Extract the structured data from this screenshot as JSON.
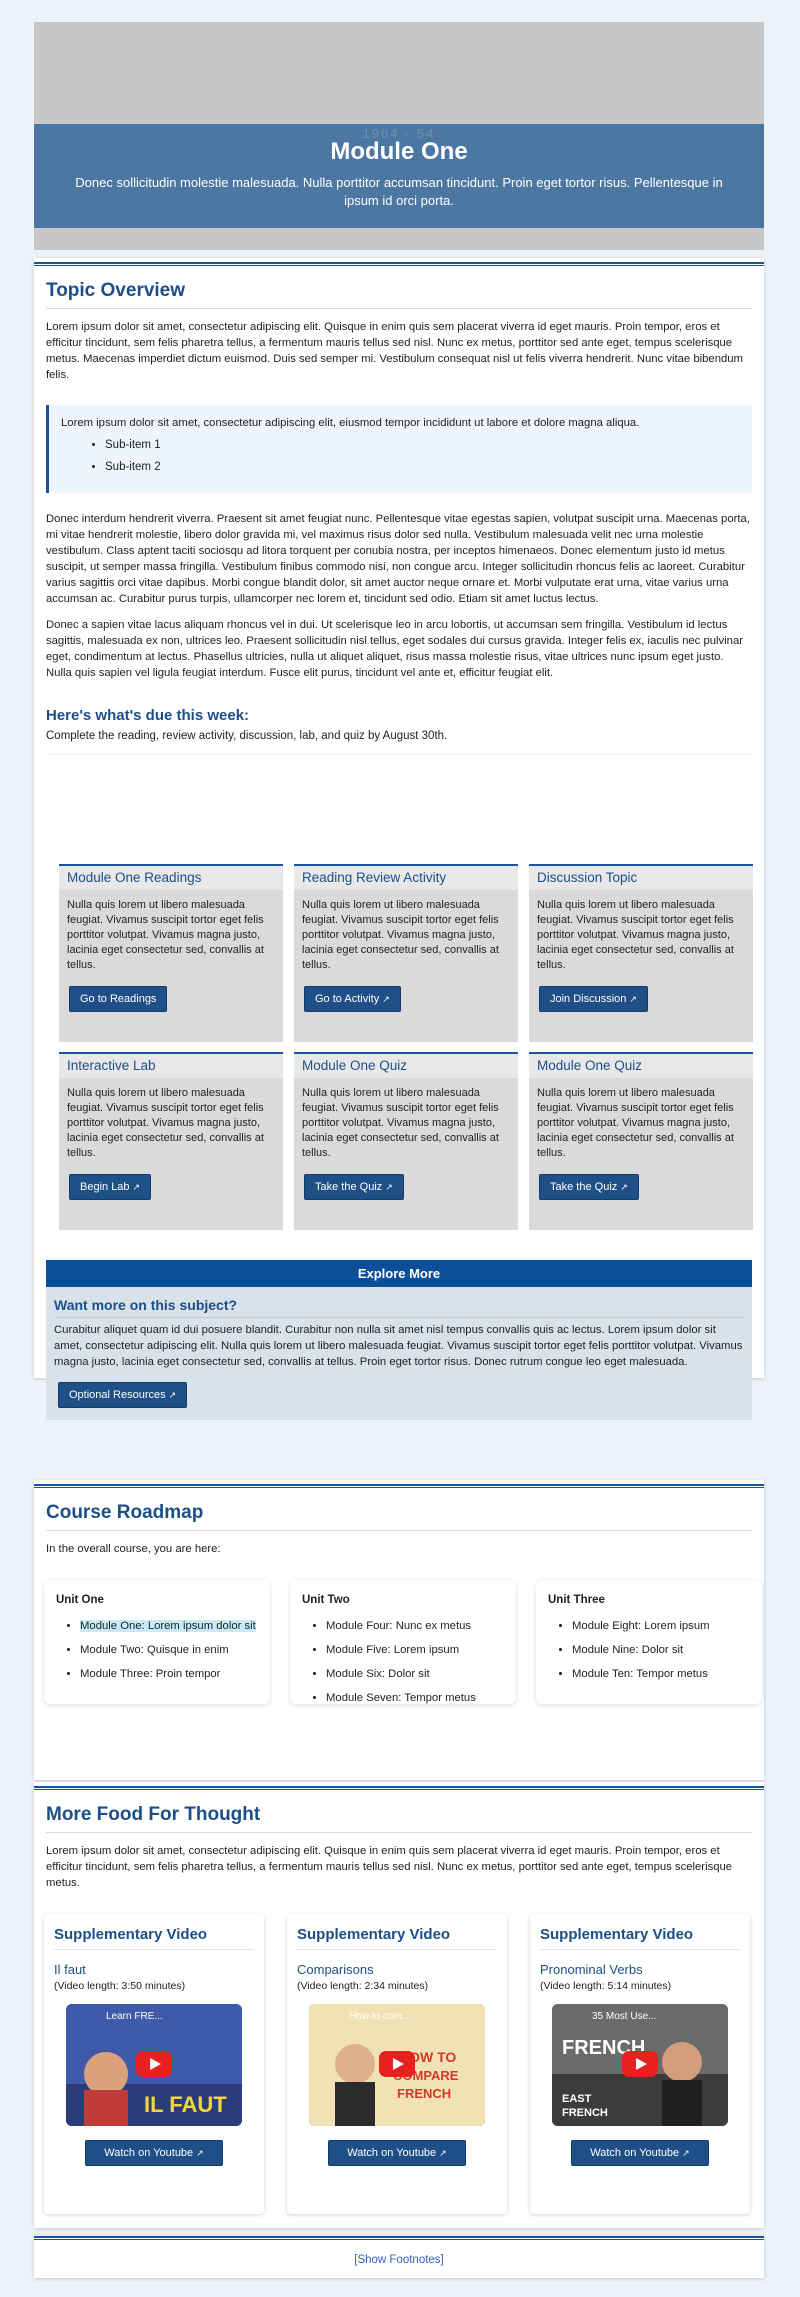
{
  "hero": {
    "ghost_text": "1984 - 54",
    "title": "Module One",
    "subtitle": "Donec sollicitudin molestie malesuada. Nulla porttitor accumsan tincidunt. Proin eget tortor risus. Pellentesque in ipsum id orci porta."
  },
  "overview": {
    "title": "Topic Overview",
    "p1": "Lorem ipsum dolor sit amet, consectetur adipiscing elit. Quisque in enim quis sem placerat viverra id eget mauris. Proin tempor, eros et efficitur tincidunt, sem felis pharetra tellus, a fermentum mauris tellus sed nisl. Nunc ex metus, porttitor sed ante eget, tempus scelerisque metus. Maecenas imperdiet dictum euismod. Duis sed semper mi. Vestibulum consequat nisl ut felis viverra hendrerit. Nunc vitae bibendum felis.",
    "callout_text": "Lorem ipsum dolor sit amet, consectetur adipiscing elit, eiusmod tempor incididunt ut labore et dolore magna aliqua.",
    "callout_items": [
      "Sub-item 1",
      "Sub-item 2"
    ],
    "p2": "Donec interdum hendrerit viverra. Praesent sit amet feugiat nunc. Pellentesque vitae egestas sapien, volutpat suscipit urna. Maecenas porta, mi vitae hendrerit molestie, libero dolor gravida mi, vel maximus risus dolor sed nulla. Vestibulum malesuada velit nec urna molestie vestibulum. Class aptent taciti sociosqu ad litora torquent per conubia nostra, per inceptos himenaeos. Donec elementum justo id metus suscipit, ut semper massa fringilla. Vestibulum finibus commodo nisi, non congue arcu. Integer sollicitudin rhoncus felis ac laoreet. Curabitur varius sagittis orci vitae dapibus. Morbi congue blandit dolor, sit amet auctor neque ornare et. Morbi vulputate erat urna, vitae varius urna accumsan ac. Curabitur purus turpis, ullamcorper nec lorem et, tincidunt sed odio. Etiam sit amet luctus lectus.",
    "p3": "Donec a sapien vitae lacus aliquam rhoncus vel in dui. Ut scelerisque leo in arcu lobortis, ut accumsan sem fringilla. Vestibulum id lectus sagittis, malesuada ex non, ultrices leo. Praesent sollicitudin nisl tellus, eget sodales dui cursus gravida. Integer felis ex, iaculis nec pulvinar eget, condimentum at lectus. Phasellus ultricies, nulla ut aliquet aliquet, risus massa molestie risus, vitae ultrices nunc ipsum eget justo. Nulla quis sapien vel ligula feugiat interdum. Fusce elit purus, tincidunt vel ante et, efficitur feugiat elit.",
    "due_title": "Here's what's due this week:",
    "due_text": "Complete the reading, review activity, discussion, lab, and quiz by August 30th."
  },
  "activities": [
    {
      "title": "Module One Readings",
      "body": "Nulla quis lorem ut libero malesuada feugiat. Vivamus suscipit tortor eget felis porttitor volutpat. Vivamus magna justo, lacinia eget consectetur sed, convallis at tellus.",
      "button": "Go to Readings",
      "external": false
    },
    {
      "title": "Reading Review Activity",
      "body": "Nulla quis lorem ut libero malesuada feugiat. Vivamus suscipit tortor eget felis porttitor volutpat. Vivamus magna justo, lacinia eget consectetur sed, convallis at tellus.",
      "button": "Go to Activity",
      "external": true
    },
    {
      "title": "Discussion Topic",
      "body": "Nulla quis lorem ut libero malesuada feugiat. Vivamus suscipit tortor eget felis porttitor volutpat. Vivamus magna justo, lacinia eget consectetur sed, convallis at tellus.",
      "button": "Join Discussion",
      "external": true
    },
    {
      "title": "Interactive Lab",
      "body": "Nulla quis lorem ut libero malesuada feugiat. Vivamus suscipit tortor eget felis porttitor volutpat. Vivamus magna justo, lacinia eget consectetur sed, convallis at tellus.",
      "button": "Begin Lab",
      "external": true
    },
    {
      "title": "Module One Quiz",
      "body": "Nulla quis lorem ut libero malesuada feugiat. Vivamus suscipit tortor eget felis porttitor volutpat. Vivamus magna justo, lacinia eget consectetur sed, convallis at tellus.",
      "button": "Take the Quiz",
      "external": true
    },
    {
      "title": "Module One Quiz",
      "body": "Nulla quis lorem ut libero malesuada feugiat. Vivamus suscipit tortor eget felis porttitor volutpat. Vivamus magna justo, lacinia eget consectetur sed, convallis at tellus.",
      "button": "Take the Quiz",
      "external": true
    }
  ],
  "explore": {
    "header": "Explore More",
    "title": "Want more on this subject?",
    "body": "Curabitur aliquet quam id dui posuere blandit. Curabitur non nulla sit amet nisl tempus convallis quis ac lectus. Lorem ipsum dolor sit amet, consectetur adipiscing elit. Nulla quis lorem ut libero malesuada feugiat. Vivamus suscipit tortor eget felis porttitor volutpat. Vivamus magna justo, lacinia eget consectetur sed, convallis at tellus. Proin eget tortor risus. Donec rutrum congue leo eget malesuada.",
    "button": "Optional Resources"
  },
  "roadmap": {
    "title": "Course Roadmap",
    "intro": "In the overall course, you are here:",
    "units": [
      {
        "title": "Unit One",
        "items": [
          "Module One: Lorem ipsum dolor sit",
          "Module Two: Quisque in enim",
          "Module Three: Proin tempor"
        ]
      },
      {
        "title": "Unit Two",
        "items": [
          "Module Four: Nunc ex metus",
          "Module Five: Lorem ipsum",
          "Module Six: Dolor sit",
          "Module Seven: Tempor metus"
        ]
      },
      {
        "title": "Unit Three",
        "items": [
          "Module Eight: Lorem ipsum",
          "Module Nine: Dolor sit",
          "Module Ten: Tempor metus"
        ]
      }
    ]
  },
  "food": {
    "title": "More Food For Thought",
    "body": "Lorem ipsum dolor sit amet, consectetur adipiscing elit. Quisque in enim quis sem placerat viverra id eget mauris. Proin tempor, eros et efficitur tincidunt, sem felis pharetra tellus, a fermentum mauris tellus sed nisl. Nunc ex metus, porttitor sed ante eget, tempus scelerisque metus.",
    "videos": [
      {
        "heading": "Supplementary Video",
        "name": "Il faut",
        "length": "(Video length: 3:50 minutes)",
        "thumb_caption": "Learn FRE...",
        "button": "Watch on Youtube"
      },
      {
        "heading": "Supplementary Video",
        "name": "Comparisons",
        "length": "(Video length: 2:34 minutes)",
        "thumb_caption": "How to com...",
        "button": "Watch on Youtube"
      },
      {
        "heading": "Supplementary Video",
        "name": "Pronominal Verbs",
        "length": "(Video length: 5:14 minutes)",
        "thumb_caption": "35 Most Use...",
        "button": "Watch on Youtube"
      }
    ]
  },
  "footer": {
    "link": "[Show Footnotes]"
  },
  "colors": {
    "accent": "#1c4f87",
    "button": "#1e4f86",
    "hero_band": "#4c77a2",
    "explore_header": "#0c4f99"
  }
}
